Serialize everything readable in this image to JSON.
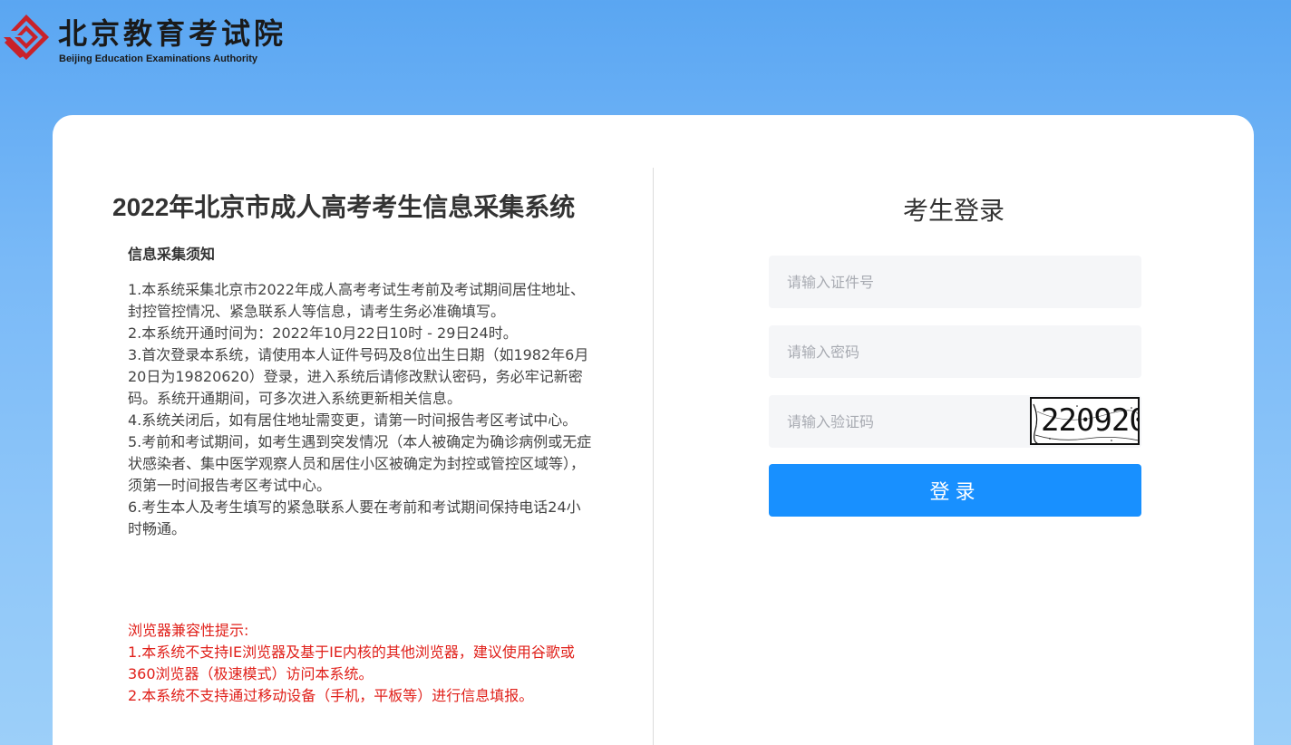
{
  "logo": {
    "name_cn": "北京教育考试院",
    "name_en": "Beijing Education Examinations Authority",
    "brand_color": "#c8222a"
  },
  "system": {
    "title": "2022年北京市成人高考考生信息采集系统"
  },
  "notice": {
    "heading": "信息采集须知",
    "items": [
      "1.本系统采集北京市2022年成人高考考试生考前及考试期间居住地址、封控管控情况、紧急联系人等信息，请考生务必准确填写。",
      "2.本系统开通时间为：2022年10月22日10时 - 29日24时。",
      "3.首次登录本系统，请使用本人证件号码及8位出生日期（如1982年6月20日为19820620）登录，进入系统后请修改默认密码，务必牢记新密码。系统开通期间，可多次进入系统更新相关信息。",
      "4.系统关闭后，如有居住地址需变更，请第一时间报告考区考试中心。",
      "5.考前和考试期间，如考生遇到突发情况（本人被确定为确诊病例或无症状感染者、集中医学观察人员和居住小区被确定为封控或管控区域等），须第一时间报告考区考试中心。",
      "6.考生本人及考生填写的紧急联系人要在考前和考试期间保持电话24小时畅通。"
    ]
  },
  "browser_tip": {
    "heading": "浏览器兼容性提示:",
    "items": [
      "1.本系统不支持IE浏览器及基于IE内核的其他浏览器，建议使用谷歌或360浏览器（极速模式）访问本系统。",
      "2.本系统不支持通过移动设备（手机，平板等）进行信息填报。"
    ],
    "color": "#e0201a"
  },
  "login": {
    "title": "考生登录",
    "id_input": {
      "value": "",
      "placeholder": "请输入证件号"
    },
    "password_input": {
      "value": "",
      "placeholder": "请输入密码"
    },
    "captcha_input": {
      "value": "",
      "placeholder": "请输入验证码"
    },
    "captcha_text": "220920",
    "submit_label": "登录",
    "accent_color": "#1890ff"
  }
}
